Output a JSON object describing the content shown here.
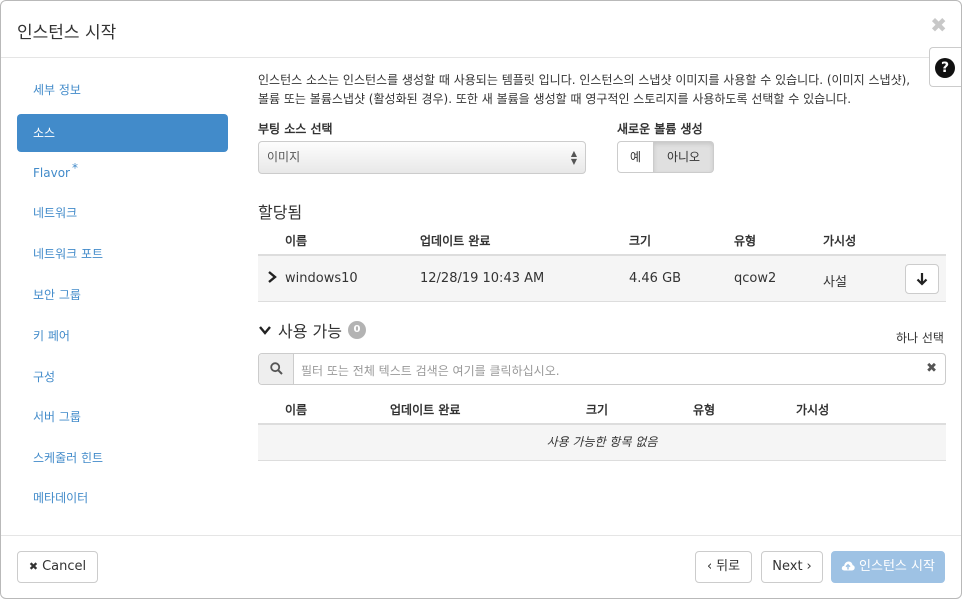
{
  "header": {
    "title": "인스턴스 시작",
    "close": "✖"
  },
  "help": {
    "label": "?"
  },
  "sidebar": {
    "items": [
      {
        "label": "세부 정보",
        "required": ""
      },
      {
        "label": "소스",
        "required": ""
      },
      {
        "label": "Flavor",
        "required": "*"
      },
      {
        "label": "네트워크",
        "required": ""
      },
      {
        "label": "네트워크 포트",
        "required": ""
      },
      {
        "label": "보안 그룹",
        "required": ""
      },
      {
        "label": "키 페어",
        "required": ""
      },
      {
        "label": "구성",
        "required": ""
      },
      {
        "label": "서버 그룹",
        "required": ""
      },
      {
        "label": "스케줄러 힌트",
        "required": ""
      },
      {
        "label": "메타데이터",
        "required": ""
      }
    ]
  },
  "content": {
    "description_line1": "인스턴스 소스는 인스턴스를 생성할 때 사용되는 템플릿 입니다. 인스턴스의 스냅샷 이미지를 사용할 수 있습니다. (이미지 스냅샷),",
    "description_line2": "볼륨 또는 볼륨스냅샷 (활성화된 경우). 또한 새 볼륨을 생성할 때 영구적인 스토리지를 사용하도록 선택할 수 있습니다.",
    "boot_source_label": "부팅 소스 선택",
    "boot_source_value": "이미지",
    "new_volume_label": "새로운 볼륨 생성",
    "new_volume_yes": "예",
    "new_volume_no": "아니오"
  },
  "allocated": {
    "title": "할당됨",
    "columns": [
      "이름",
      "업데이트 완료",
      "크기",
      "유형",
      "가시성"
    ],
    "rows": [
      {
        "name": "windows10",
        "updated": "12/28/19 10:43 AM",
        "size": "4.46 GB",
        "type": "qcow2",
        "visibility": "사설"
      }
    ]
  },
  "available": {
    "title": "사용 가능",
    "count": "0",
    "select_one": "하나 선택",
    "search_placeholder": "필터 또는 전체 텍스트 검색은 여기를 클릭하십시오.",
    "columns": [
      "이름",
      "업데이트 완료",
      "크기",
      "유형",
      "가시성"
    ],
    "empty_text": "사용 가능한 항목 없음"
  },
  "footer": {
    "cancel": "Cancel",
    "back": "뒤로",
    "next": "Next",
    "launch": "인스턴스 시작"
  },
  "colors": {
    "accent": "#428bca",
    "launch_disabled": "#9ec2e4"
  }
}
